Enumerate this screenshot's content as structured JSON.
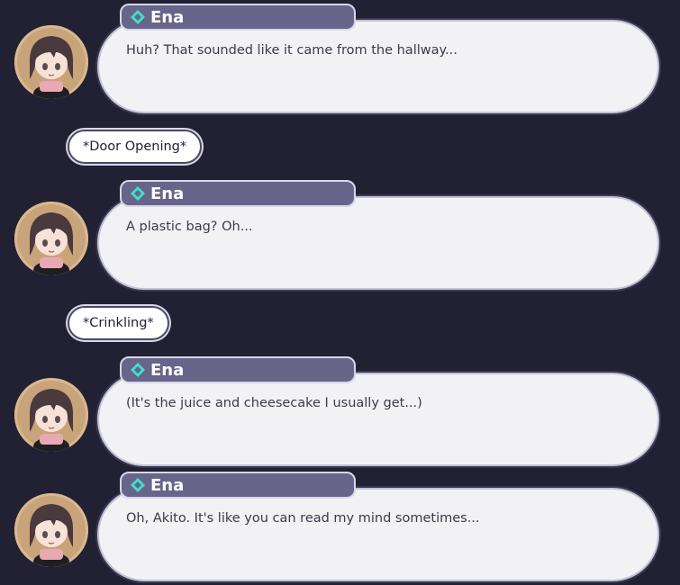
{
  "dialogue": [
    {
      "speaker": "Ena",
      "text": "Huh? That sounded like it came from the hallway..."
    },
    {
      "speaker": "Ena",
      "text": "A plastic bag? Oh..."
    },
    {
      "speaker": "Ena",
      "text": "(It's the juice and cheesecake I usually get...)"
    },
    {
      "speaker": "Ena",
      "text": "Oh, Akito. It's like you can read my mind sometimes..."
    }
  ],
  "sound_effects": [
    {
      "text": "*Door Opening*"
    },
    {
      "text": "*Crinkling*"
    }
  ],
  "colors": {
    "background": "#222133",
    "name_tag": "#67658a",
    "speaker_gem": "#3fe0c8",
    "bubble": "#f2f2f4"
  },
  "icons": {
    "speaker_marker": "diamond-gem-icon",
    "avatar": "ena-chibi-portrait"
  }
}
